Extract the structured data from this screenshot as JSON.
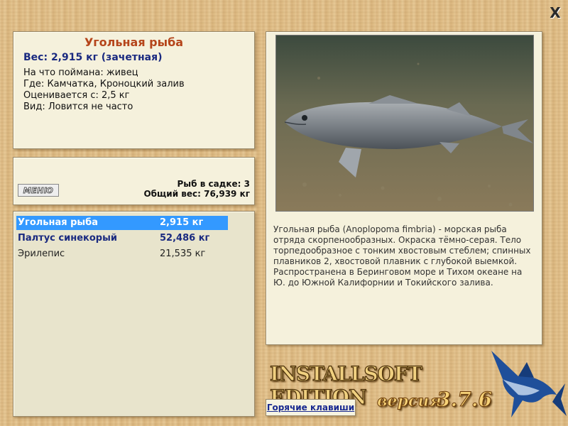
{
  "window": {
    "close_symbol": "X"
  },
  "info": {
    "title": "Угольная рыба",
    "weight": "Вес: 2,915 кг (зачетная)",
    "lines": [
      {
        "label": "На что поймана: ",
        "value": "живец"
      },
      {
        "label": "Где: ",
        "value": "Камчатка, Кроноцкий залив"
      },
      {
        "label": "Оценивается с: ",
        "value": "2,5 кг"
      },
      {
        "label": "Вид: ",
        "value": "Ловится не часто"
      }
    ]
  },
  "summary": {
    "menu_label": "МЕНЮ",
    "fish_count": "Рыб в садке: 3",
    "total_weight": "Общий вес: 76,939 кг"
  },
  "catch_list": [
    {
      "name": "Угольная рыба",
      "weight": "2,915 кг",
      "state": "selected"
    },
    {
      "name": "Палтус синекорый",
      "weight": "52,486 кг",
      "state": "trophy"
    },
    {
      "name": "Эрилепис",
      "weight": "21,535 кг",
      "state": "normal"
    }
  ],
  "description": "Угольная рыба (Anoplopoma fimbria) - морская рыба отряда скорпенообразных. Окраска тёмно-серая. Тело торпедообразное с тонким хвостовым стеблем; спинных плавников 2, хвостовой плавник с глубокой выемкой. Распространена в Беринговом море и Тихом океане на Ю. до Южной Калифорнии и Токийского залива.",
  "branding": {
    "edition": "INSTALLSOFT EDITION",
    "version_word": "версия",
    "version_number": "3.7.6"
  },
  "hotkeys_label": "Горячие клавиши",
  "icons": {
    "close": "close-icon",
    "logo": "marlin-logo-icon"
  },
  "colors": {
    "title": "#b5451b",
    "weight": "#1a2a80",
    "selected_row": "#3399ff",
    "panel_bg": "#f5f1dc"
  }
}
